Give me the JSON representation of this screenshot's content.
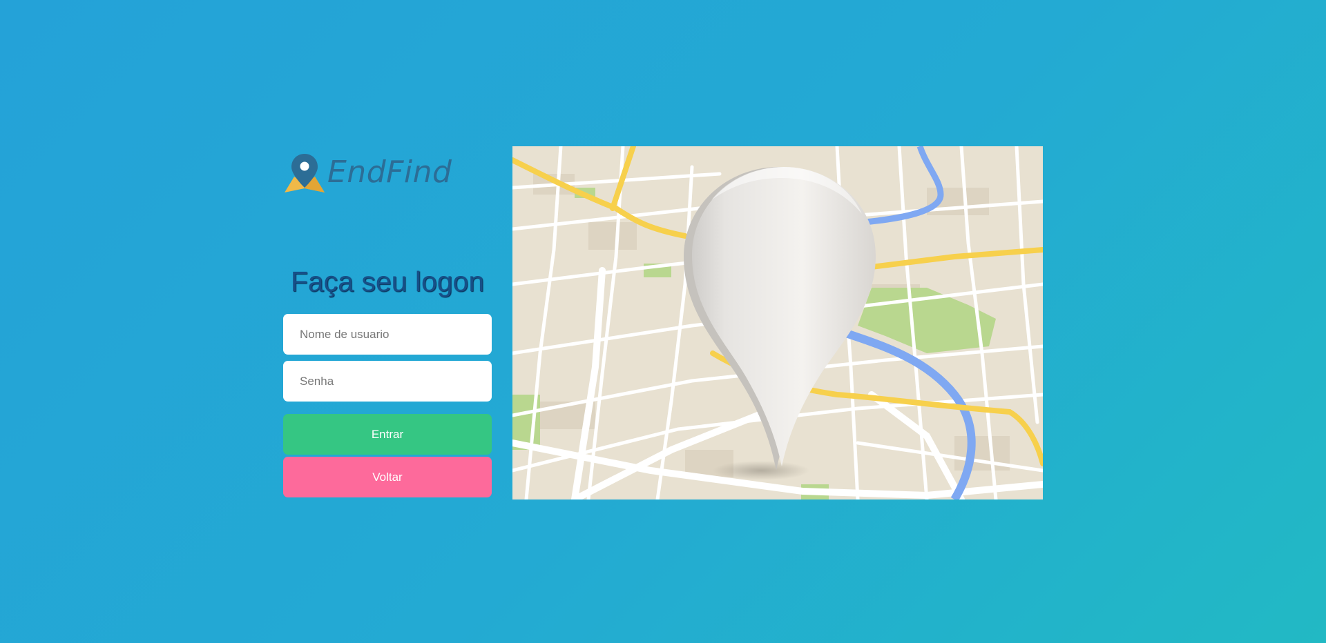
{
  "brand": {
    "name": "EndFind",
    "icon": "map-pin-icon"
  },
  "login": {
    "title": "Faça seu logon",
    "username_placeholder": "Nome de usuario",
    "password_placeholder": "Senha",
    "enter_label": "Entrar",
    "back_label": "Voltar"
  },
  "illustration": {
    "icon": "map-location-pin-illustration"
  },
  "colors": {
    "background": "#24a2d8",
    "title": "#174f87",
    "enter_button": "#35c683",
    "back_button": "#fd6a9b",
    "brand_text": "#2c6d96",
    "brand_accent": "#f0b948"
  }
}
